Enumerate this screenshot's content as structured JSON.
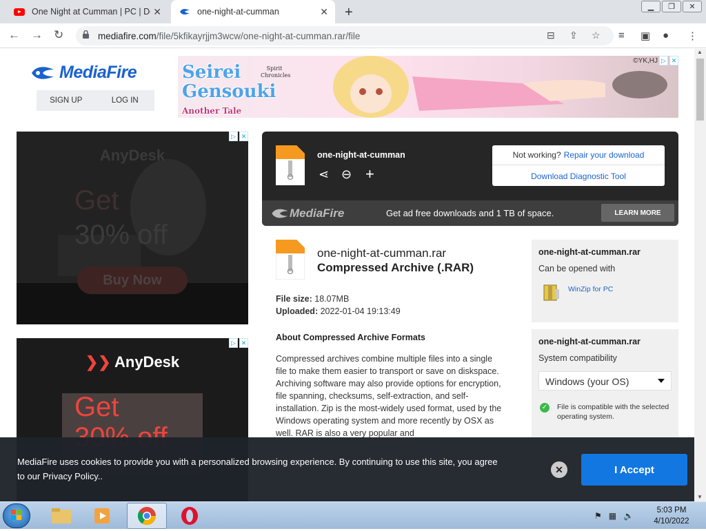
{
  "browser": {
    "tabs": [
      {
        "title": "One Night at Cumman | PC | Dow",
        "active": false
      },
      {
        "title": "one-night-at-cumman",
        "active": true
      }
    ],
    "url_domain": "mediafire.com",
    "url_path": "/file/5kfikayrjjm3wcw/one-night-at-cumman.rar/file"
  },
  "header": {
    "logo": "MediaFire",
    "signup": "SIGN UP",
    "login": "LOG IN"
  },
  "banner": {
    "title_line1": "Seirei",
    "title_line2": "Gensouki",
    "title_line3": "Another Tale",
    "subtitle": "Spirit Chronicles",
    "copyright": "©YK,HJ"
  },
  "ads": [
    {
      "brand": "AnyDesk",
      "headline": "Get",
      "offer": "30% off",
      "cta": "Buy Now"
    },
    {
      "brand": "AnyDesk",
      "headline": "Get",
      "offer": "30% off"
    }
  ],
  "download": {
    "name": "one-night-at-cumman",
    "not_working": "Not working?",
    "repair": "Repair your download",
    "diagnostic": "Download Diagnostic Tool",
    "promo_logo": "MediaFire",
    "promo": "Get ad free downloads and 1 TB of space.",
    "learn_more": "LEARN MORE"
  },
  "file": {
    "filename": "one-night-at-cumman.rar",
    "type": "Compressed Archive (.RAR)",
    "size_label": "File size:",
    "size": "18.07MB",
    "uploaded_label": "Uploaded:",
    "uploaded": "2022-01-04 19:13:49",
    "about_heading": "About Compressed Archive Formats",
    "about": "Compressed archives combine multiple files into a single file to make them easier to transport or save on diskspace. Archiving software may also provide options for encryption, file spanning, checksums, self-extraction, and self-installation. Zip is the most-widely used format, used by the Windows operating system and more recently by OSX as well. RAR is also a very popular and"
  },
  "sidebar": {
    "open_filename": "one-night-at-cumman.rar",
    "open_with": "Can be opened with",
    "app": "WinZip for PC",
    "compat_filename": "one-night-at-cumman.rar",
    "compat_label": "System compatibility",
    "os_select": "Windows (your OS)",
    "compat_note": "File is compatible with the selected operating system."
  },
  "cookie": {
    "text": "MediaFire uses cookies to provide you with a personalized browsing experience. By continuing to use this site, you agree to our Privacy Policy..",
    "accept": "I Accept"
  },
  "taskbar": {
    "time": "5:03 PM",
    "date": "4/10/2022"
  },
  "colors": {
    "brand_blue": "#1a62cf",
    "accept_blue": "#1277e1",
    "anydesk_red": "#ef443b"
  }
}
